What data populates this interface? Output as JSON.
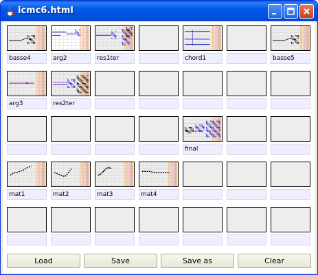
{
  "window": {
    "title": "icmc6.html"
  },
  "grid": {
    "cells": [
      {
        "label": "basse4",
        "thumb": "a"
      },
      {
        "label": "arg2",
        "thumb": "b"
      },
      {
        "label": "res1ter",
        "thumb": "c"
      },
      {
        "label": "",
        "thumb": null
      },
      {
        "label": "chord1",
        "thumb": "d"
      },
      {
        "label": "",
        "thumb": null
      },
      {
        "label": "basse5",
        "thumb": "a"
      },
      {
        "label": "arg3",
        "thumb": "e"
      },
      {
        "label": "res2ter",
        "thumb": "f"
      },
      {
        "label": "",
        "thumb": null
      },
      {
        "label": "",
        "thumb": null
      },
      {
        "label": "",
        "thumb": null
      },
      {
        "label": "",
        "thumb": null
      },
      {
        "label": "",
        "thumb": null
      },
      {
        "label": "",
        "thumb": null
      },
      {
        "label": "",
        "thumb": null
      },
      {
        "label": "",
        "thumb": null
      },
      {
        "label": "",
        "thumb": null
      },
      {
        "label": "final",
        "thumb": "g"
      },
      {
        "label": "",
        "thumb": null
      },
      {
        "label": "",
        "thumb": null
      },
      {
        "label": "mat1",
        "thumb": "h"
      },
      {
        "label": "mat2",
        "thumb": "i"
      },
      {
        "label": "mat3",
        "thumb": "j"
      },
      {
        "label": "mat4",
        "thumb": "k"
      },
      {
        "label": "",
        "thumb": null
      },
      {
        "label": "",
        "thumb": null
      },
      {
        "label": "",
        "thumb": null
      },
      {
        "label": "",
        "thumb": null
      },
      {
        "label": "",
        "thumb": null
      },
      {
        "label": "",
        "thumb": null
      },
      {
        "label": "",
        "thumb": null
      },
      {
        "label": "",
        "thumb": null
      },
      {
        "label": "",
        "thumb": null
      },
      {
        "label": "",
        "thumb": null
      }
    ]
  },
  "buttons": {
    "load": "Load",
    "save": "Save",
    "save_as": "Save as",
    "clear": "Clear"
  },
  "colors": {
    "titlebar": "#0058e6",
    "label_bg": "#eeeeff",
    "thumb_bg": "#ededed"
  }
}
